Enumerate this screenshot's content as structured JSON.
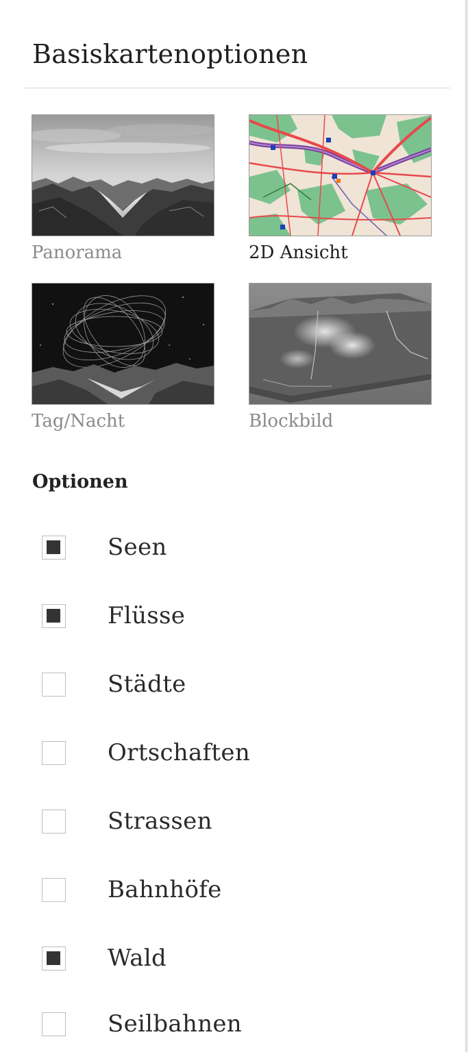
{
  "panel": {
    "title": "Basiskartenoptionen"
  },
  "basemaps": [
    {
      "label": "Panorama",
      "icon": "panorama-thumbnail",
      "selected": false
    },
    {
      "label": "2D Ansicht",
      "icon": "2d-map-thumbnail",
      "selected": true
    },
    {
      "label": "Tag/Nacht",
      "icon": "day-night-thumbnail",
      "selected": false
    },
    {
      "label": "Blockbild",
      "icon": "block-diagram-thumbnail",
      "selected": false
    }
  ],
  "options": {
    "heading": "Optionen",
    "items": [
      {
        "label": "Seen",
        "checked": true
      },
      {
        "label": "Flüsse",
        "checked": true
      },
      {
        "label": "Städte",
        "checked": false
      },
      {
        "label": "Ortschaften",
        "checked": false
      },
      {
        "label": "Strassen",
        "checked": false
      },
      {
        "label": "Bahnhöfe",
        "checked": false
      },
      {
        "label": "Wald",
        "checked": true
      },
      {
        "label": "Seilbahnen",
        "checked": false
      }
    ]
  },
  "colors": {
    "selected_label": "#1f1f1f",
    "unselected_label": "#8a8a8a",
    "checkbox_fill": "#333333",
    "map_roads": "#e8484a",
    "map_forest": "#7cc28e",
    "map_rivers": "#7a3f9e",
    "map_stations": "#1c3fb8"
  }
}
